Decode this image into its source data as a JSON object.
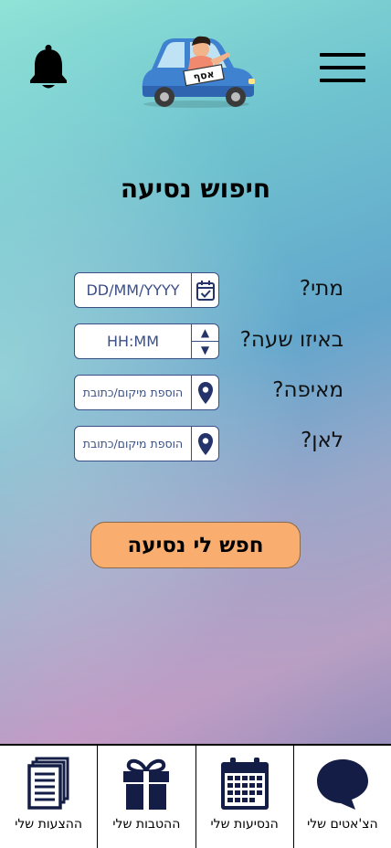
{
  "header": {
    "logo_text": "אסף"
  },
  "page": {
    "title": "חיפוש נסיעה"
  },
  "form": {
    "when": {
      "label": "מתי?",
      "value": "DD/MM/YYYY"
    },
    "time": {
      "label": "באיזו שעה?",
      "value": "HH:MM"
    },
    "from": {
      "label": "מאיפה?",
      "placeholder": "הוספת מיקום/כתובת"
    },
    "to": {
      "label": "לאן?",
      "placeholder": "הוספת מיקום/כתובת"
    }
  },
  "search_button": {
    "label": "חפש לי נסיעה"
  },
  "bottom_nav": {
    "chats": "הצ'אטים שלי",
    "rides": "הנסיעות שלי",
    "benefits": "ההטבות שלי",
    "offers": "ההצעות שלי"
  },
  "colors": {
    "accent": "#f9ae70",
    "field_border": "#3a4f86",
    "icon_navy": "#141d45"
  }
}
